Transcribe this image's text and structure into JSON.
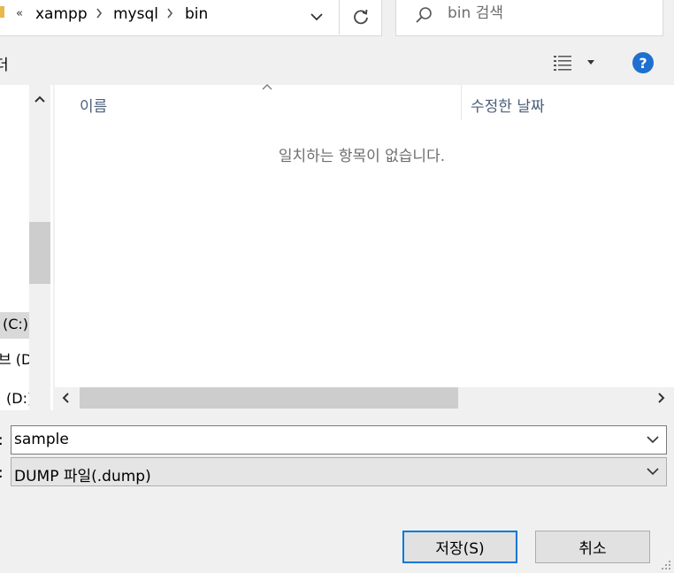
{
  "address": {
    "overflow": "«",
    "crumbs": [
      "xampp",
      "mysql",
      "bin"
    ]
  },
  "search": {
    "placeholder": "bin 검색"
  },
  "toolbar": {
    "partial_label": "더",
    "help": "?"
  },
  "nav": {
    "items": [
      {
        "label": "(C:)",
        "selected": true
      },
      {
        "label": "브 (D",
        "selected": false
      },
      {
        "label": "(D:)",
        "selected": false
      }
    ]
  },
  "file_list": {
    "columns": [
      "이름",
      "수정한 날짜"
    ],
    "empty_message": "일치하는 항목이 없습니다."
  },
  "form": {
    "filename_label": ":",
    "filename_value": "sample",
    "filetype_label": ":",
    "filetype_value": "DUMP 파일(.dump)"
  },
  "buttons": {
    "save": "저장(S)",
    "cancel": "취소"
  },
  "colors": {
    "accent": "#0078d7",
    "help": "#1e6fd0",
    "header_text": "#4c607a"
  }
}
